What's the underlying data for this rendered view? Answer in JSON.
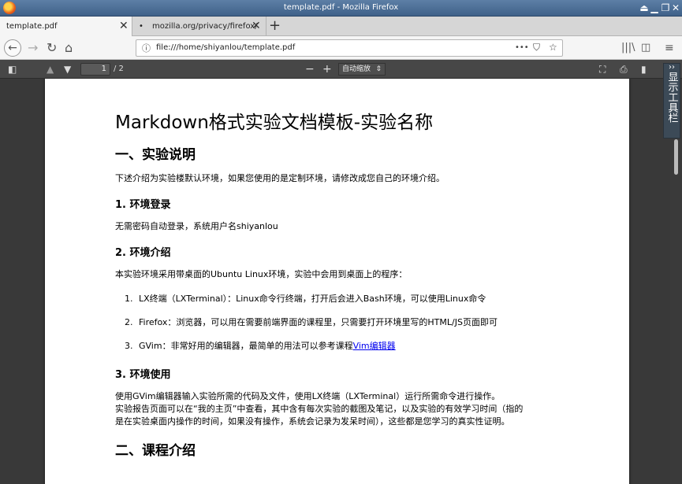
{
  "window": {
    "title": "template.pdf - Mozilla Firefox",
    "controls": [
      "⏏",
      "▁",
      "❐",
      "✕"
    ]
  },
  "tabs": [
    {
      "label": "template.pdf",
      "active": true
    },
    {
      "label": "mozilla.org/privacy/firefox/",
      "active": false
    }
  ],
  "nav": {
    "url": "file:///home/shiyanlou/template.pdf",
    "more": "•••"
  },
  "pdf_toolbar": {
    "page_current": "1",
    "page_total": "/ 2",
    "zoom": "自动缩放",
    "minus": "−",
    "plus": "+"
  },
  "side_toggle": {
    "label": "显示工具栏",
    "arrow": "››"
  },
  "document": {
    "title": "Markdown格式实验文档模板-实验名称",
    "section1": "一、实验说明",
    "intro": "下述介绍为实验楼默认环境，如果您使用的是定制环境，请修改成您自己的环境介绍。",
    "sub1": "1. 环境登录",
    "login": "无需密码自动登录，系统用户名shiyanlou",
    "sub2": "2. 环境介绍",
    "env_intro": "本实验环境采用带桌面的Ubuntu Linux环境，实验中会用到桌面上的程序：",
    "items": [
      {
        "num": "1.",
        "text": "LX终端（LXTerminal）：Linux命令行终端，打开后会进入Bash环境，可以使用Linux命令",
        "link": ""
      },
      {
        "num": "2.",
        "text": "Firefox：浏览器，可以用在需要前端界面的课程里，只需要打开环境里写的HTML/JS页面即可",
        "link": ""
      },
      {
        "num": "3.",
        "text": "GVim：非常好用的编辑器，最简单的用法可以参考课程",
        "link": "Vim编辑器"
      }
    ],
    "sub3": "3. 环境使用",
    "usage_1": "使用GVim编辑器输入实验所需的代码及文件，使用LX终端（LXTerminal）运行所需命令进行操作。",
    "usage_2": "实验报告页面可以在“我的主页”中查看，其中含有每次实验的截图及笔记，以及实验的有效学习时间（指的",
    "usage_3": "是在实验桌面内操作的时间，如果没有操作，系统会记录为发呆时间），这些都是您学习的真实性证明。",
    "section2": "二、课程介绍"
  }
}
